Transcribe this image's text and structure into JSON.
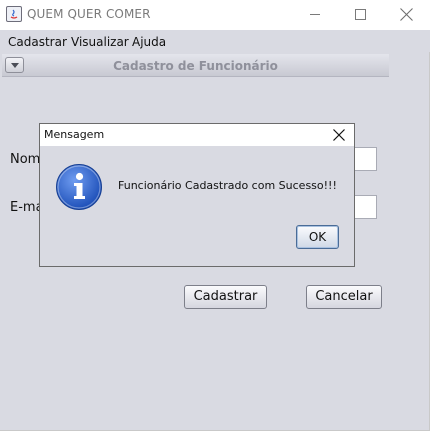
{
  "window": {
    "title": "QUEM QUER COMER"
  },
  "menubar": {
    "items": [
      "Cadastrar",
      "Visualizar",
      "Ajuda"
    ]
  },
  "internal_frame": {
    "title": "Cadastro de Funcionário"
  },
  "form": {
    "nome_label": "Nom",
    "email_label": "E-ma",
    "nome_value": "",
    "email_value": "",
    "cadastrar_label": "Cadastrar",
    "cancelar_label": "Cancelar"
  },
  "dialog": {
    "title": "Mensagem",
    "message": "Funcionário Cadastrado com Sucesso!!!",
    "ok_label": "OK",
    "icon": "info-icon"
  },
  "colors": {
    "background": "#d9dae2",
    "info_icon": "#2a61c9",
    "ok_border": "#4a6c97"
  }
}
